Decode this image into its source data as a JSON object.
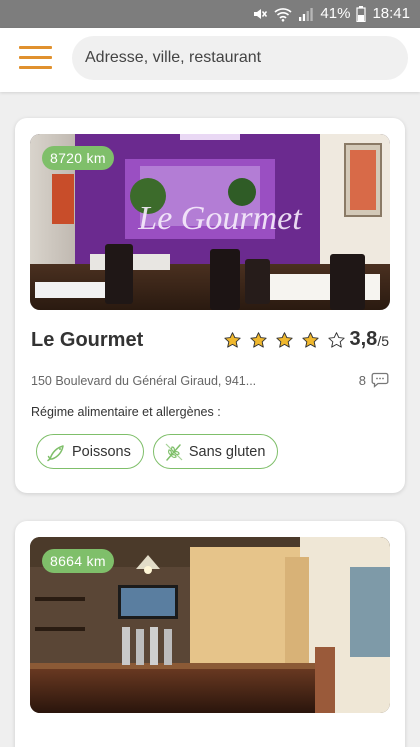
{
  "status_bar": {
    "battery_percent": "41%",
    "time": "18:41",
    "icons": [
      "mute-icon",
      "wifi-icon",
      "signal-icon",
      "battery-icon"
    ]
  },
  "header": {
    "menu_icon": "hamburger-menu-icon",
    "search_placeholder": "Adresse, ville, restaurant"
  },
  "colors": {
    "accent": "#e0912e",
    "badge_green": "#7fbf6a",
    "star_gold": "#f0b82e"
  },
  "restaurants": [
    {
      "distance": "8720 km",
      "name": "Le Gourmet",
      "photo_sign_text": "Le Gourmet",
      "rating_value": "3,8",
      "rating_max": "/5",
      "stars_filled": 4,
      "stars_total": 5,
      "address": "150 Boulevard du Général Giraud, 941...",
      "review_count": "8",
      "diet_label": "Régime alimentaire et allergènes :",
      "tags": [
        {
          "label": "Poissons",
          "icon": "fish-icon"
        },
        {
          "label": "Sans gluten",
          "icon": "wheat-icon"
        }
      ]
    },
    {
      "distance": "8664 km"
    }
  ]
}
